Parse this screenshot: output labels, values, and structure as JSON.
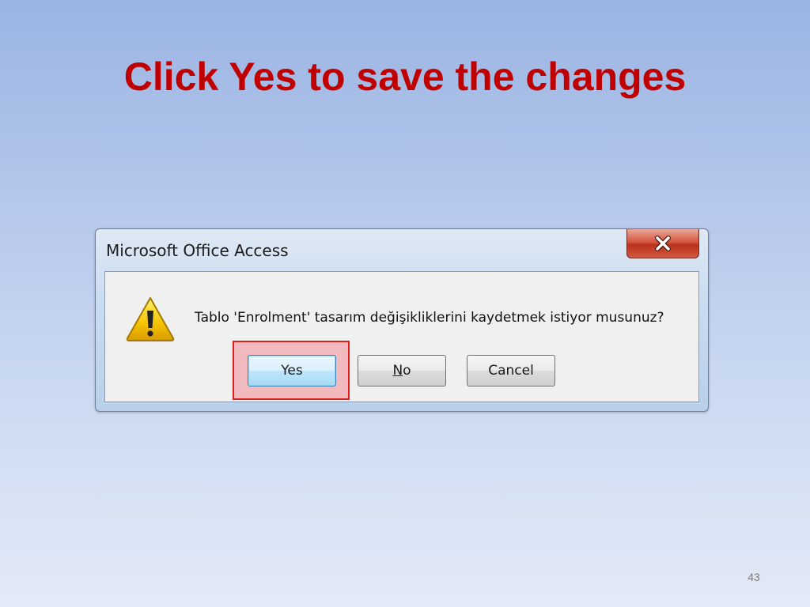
{
  "slide": {
    "title": "Click Yes to save the changes",
    "page_number": "43"
  },
  "dialog": {
    "title": "Microsoft Office Access",
    "close_icon": "close-x-icon",
    "message_icon": "warning-icon",
    "message": "Tablo 'Enrolment' tasarım değişikliklerini kaydetmek istiyor musunuz?",
    "buttons": {
      "yes": "Yes",
      "no_mnemonic": "N",
      "no_rest": "o",
      "cancel": "Cancel"
    },
    "highlighted_button": "yes"
  },
  "colors": {
    "title": "#c00000",
    "highlight_border": "#e21b1b",
    "close_button": "#c9402a",
    "background_top": "#9ab4e2",
    "background_bottom": "#e3eaf7"
  }
}
